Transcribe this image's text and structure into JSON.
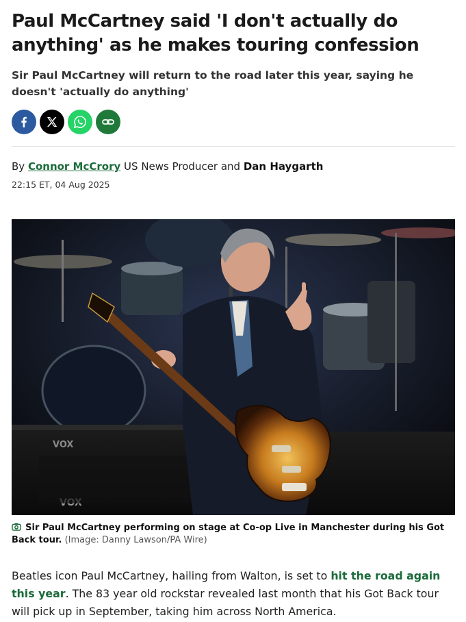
{
  "article": {
    "headline": "Paul McCartney said 'I don't actually do anything' as he makes touring confession",
    "standfirst": "Sir Paul McCartney will return to the road later this year, saying he doesn't 'actually do anything'",
    "share": [
      {
        "icon": "facebook-icon"
      },
      {
        "icon": "x-icon"
      },
      {
        "icon": "whatsapp-icon"
      },
      {
        "icon": "copy-link-icon"
      }
    ],
    "byline": {
      "prefix": "By",
      "author1": "Connor McCrory",
      "role1": "US News Producer and",
      "author2": "Dan Haygarth"
    },
    "date": "22:15 ET, 04 Aug 2025",
    "photo": {
      "amp_label_top": "VOX",
      "amp_label_bottom": "VOX"
    },
    "caption": {
      "icon": "camera-icon",
      "text": "Sir Paul McCartney performing on stage at Co-op Live in Manchester during his Got Back tour.",
      "credit": "(Image: Danny Lawson/PA Wire)"
    },
    "body": {
      "before_link": "Beatles icon Paul McCartney, hailing from Walton, is set to",
      "link": "hit the road again this year",
      "after_link": ". The 83 year old rockstar revealed last month that his Got Back tour will pick up in September, taking him across North America."
    }
  }
}
